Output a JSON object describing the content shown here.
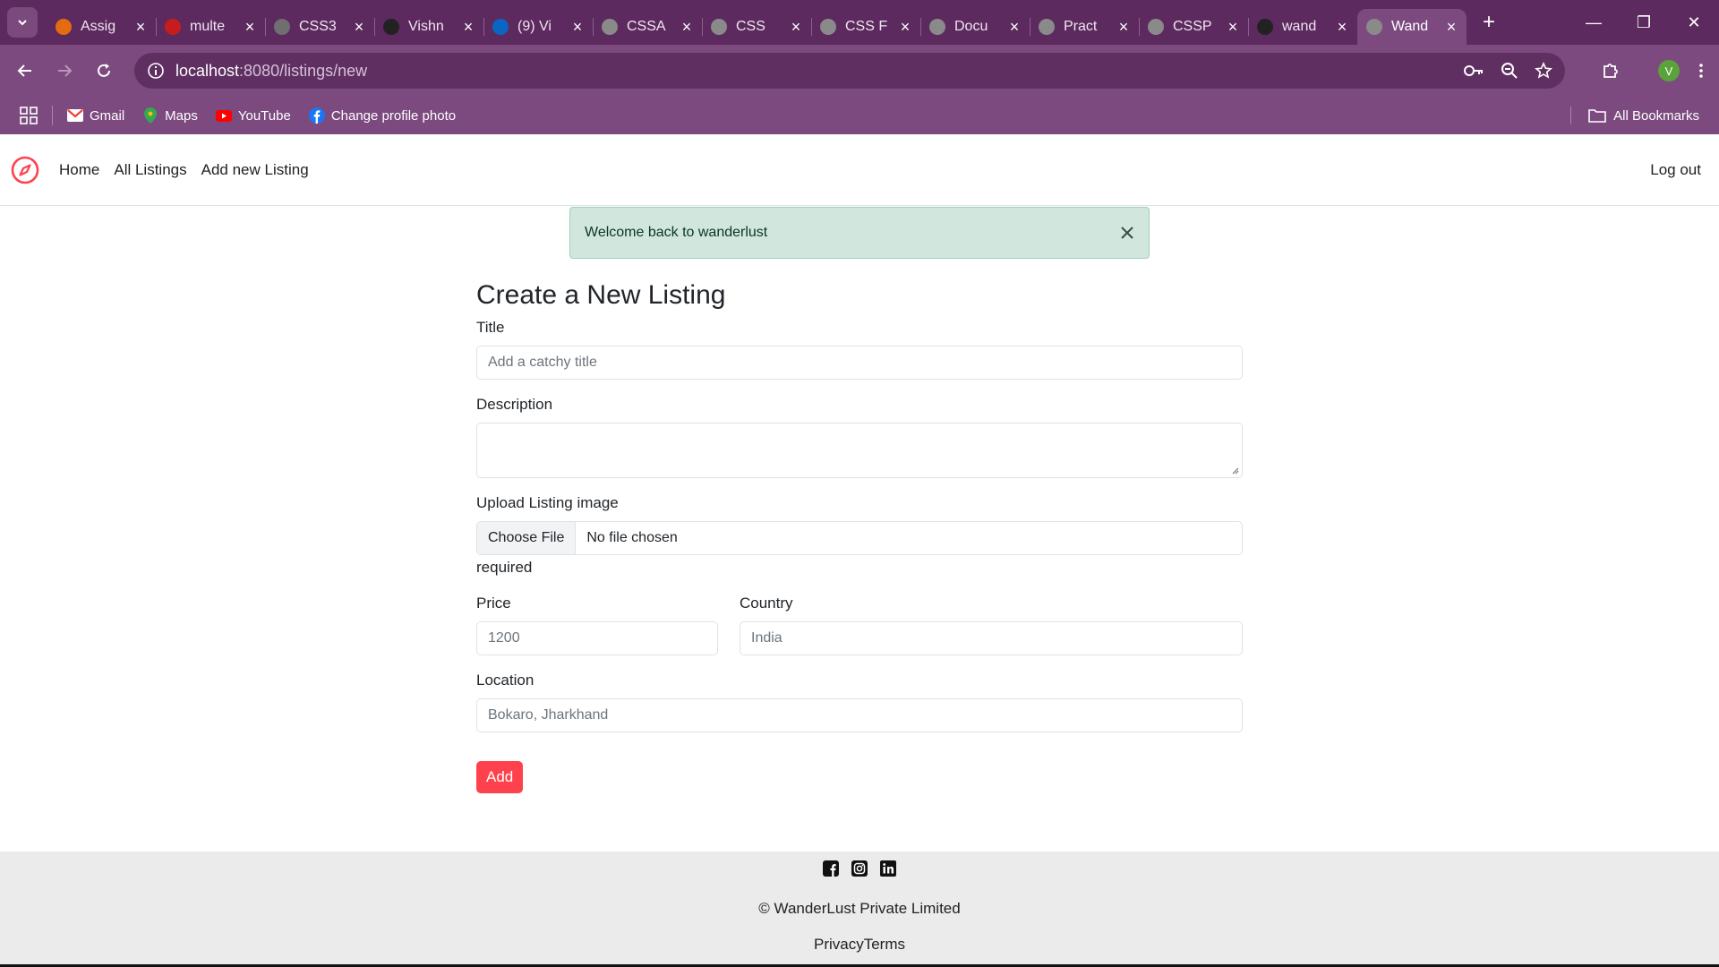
{
  "browser": {
    "tabs": [
      {
        "title": "Assig",
        "favicon_color": "#e36b10"
      },
      {
        "title": "multe",
        "favicon_color": "#c81c1c"
      },
      {
        "title": "CSS3",
        "favicon_color": "#6f6f6f"
      },
      {
        "title": "Vishn",
        "favicon_color": "#222222"
      },
      {
        "title": "(9) Vi",
        "favicon_color": "#0a66c2"
      },
      {
        "title": "CSSA",
        "favicon_color": "#8a8a8a"
      },
      {
        "title": "CSS",
        "favicon_color": "#8a8a8a"
      },
      {
        "title": "CSS F",
        "favicon_color": "#8a8a8a"
      },
      {
        "title": "Docu",
        "favicon_color": "#8a8a8a"
      },
      {
        "title": "Pract",
        "favicon_color": "#8a8a8a"
      },
      {
        "title": "CSSP",
        "favicon_color": "#8a8a8a"
      },
      {
        "title": "wand",
        "favicon_color": "#222222"
      },
      {
        "title": "Wand",
        "favicon_color": "#8a8a8a",
        "active": true
      }
    ],
    "url_host": "localhost",
    "url_path": ":8080/listings/new",
    "profile_initial": "V",
    "bookmarks": [
      {
        "label": "Gmail",
        "icon": "gmail-icon"
      },
      {
        "label": "Maps",
        "icon": "maps-icon"
      },
      {
        "label": "YouTube",
        "icon": "youtube-icon"
      },
      {
        "label": "Change profile photo",
        "icon": "facebook-icon"
      }
    ],
    "all_bookmarks": "All Bookmarks"
  },
  "site": {
    "nav": {
      "links": [
        "Home",
        "All Listings",
        "Add new Listing"
      ],
      "logout": "Log out"
    },
    "alert": "Welcome back to wanderlust",
    "form": {
      "heading": "Create a New Listing",
      "title_label": "Title",
      "title_placeholder": "Add a catchy title",
      "description_label": "Description",
      "image_label": "Upload Listing image",
      "file_button": "Choose File",
      "file_status": "No file chosen",
      "required_text": "required",
      "price_label": "Price",
      "price_placeholder": "1200",
      "country_label": "Country",
      "country_placeholder": "India",
      "location_label": "Location",
      "location_placeholder": "Bokaro, Jharkhand",
      "submit": "Add"
    },
    "footer": {
      "copyright": "© WanderLust Private Limited",
      "links": [
        "Privacy",
        "Terms"
      ]
    },
    "accent_color": "#fe424d"
  }
}
